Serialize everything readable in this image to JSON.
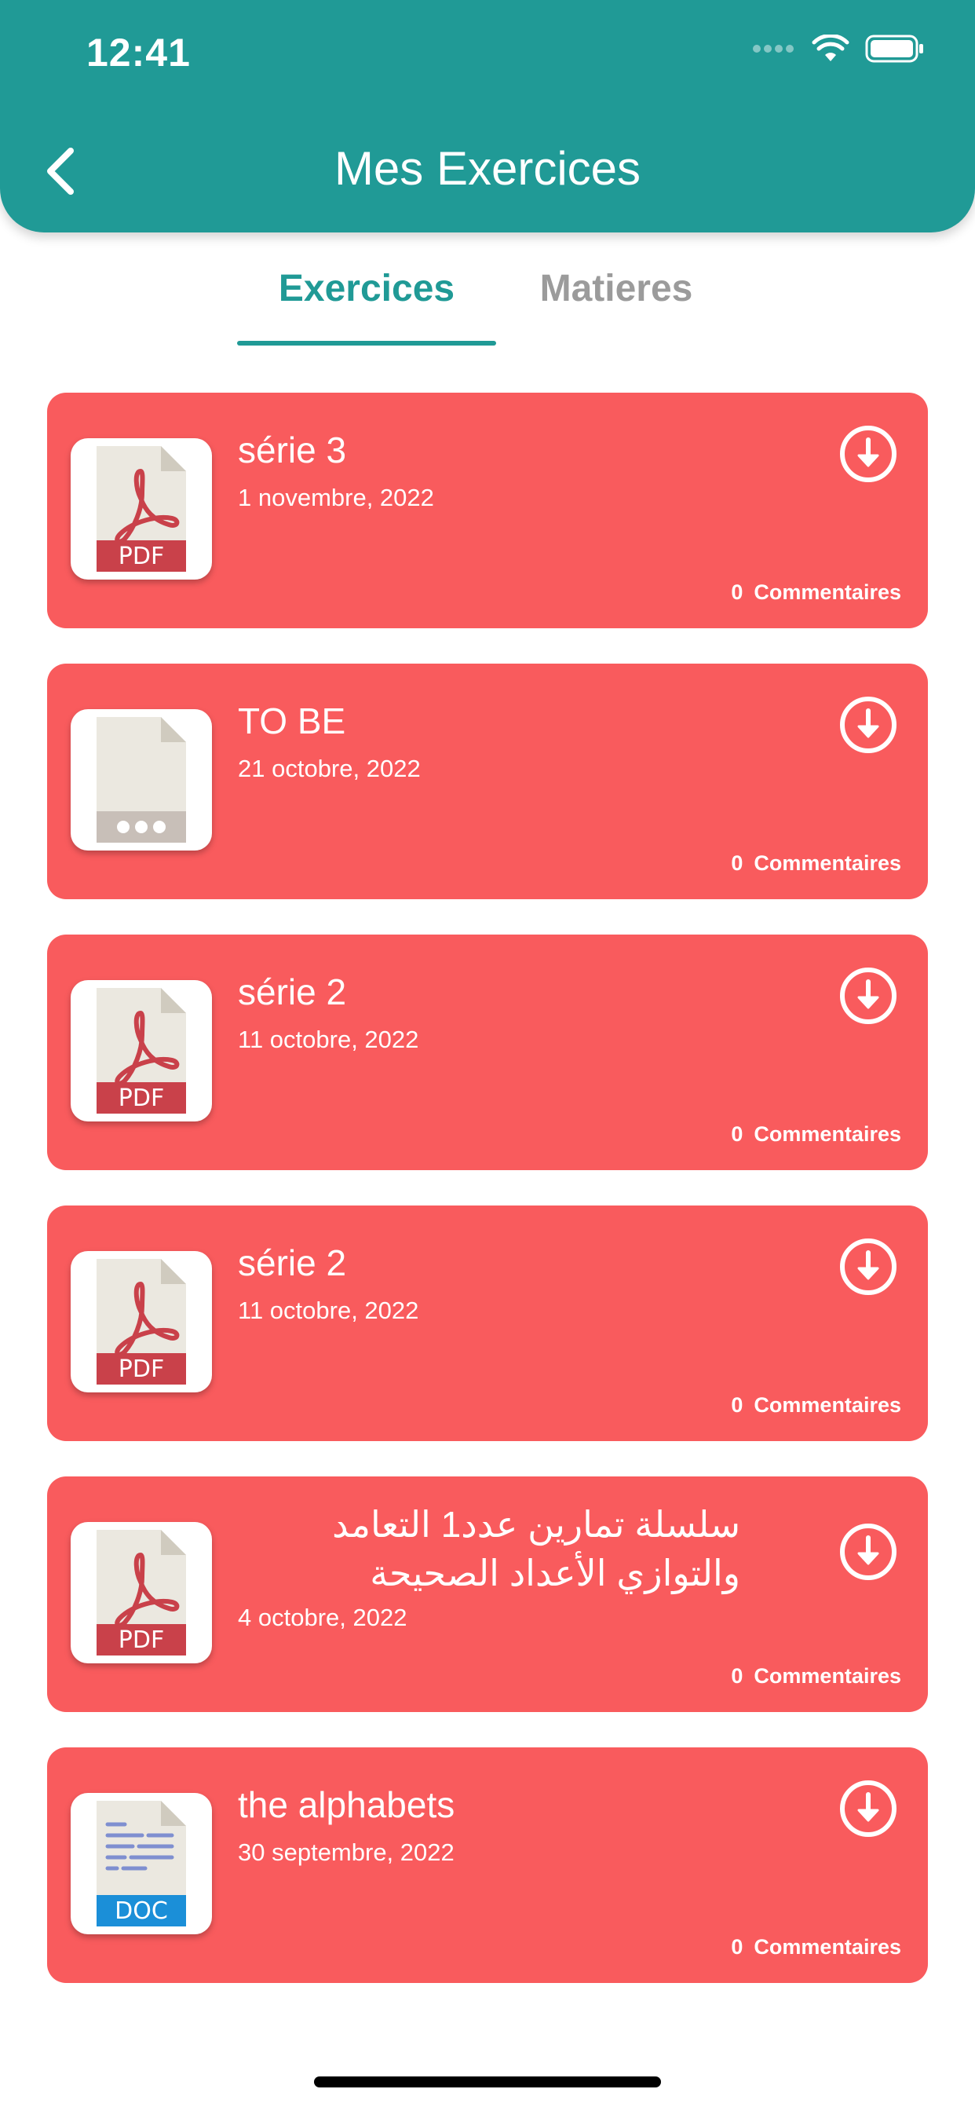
{
  "status_bar": {
    "time": "12:41"
  },
  "header": {
    "title": "Mes Exercices"
  },
  "tabs": [
    {
      "label": "Exercices",
      "active": true
    },
    {
      "label": "Matieres",
      "active": false
    }
  ],
  "exercises": [
    {
      "title": "série 3",
      "date": "1 novembre, 2022",
      "file_type": "pdf",
      "file_label": "PDF",
      "comments_count": "0",
      "comments_label": "Commentaires"
    },
    {
      "title": "TO BE",
      "date": "21 octobre, 2022",
      "file_type": "generic",
      "file_label": "",
      "comments_count": "0",
      "comments_label": "Commentaires"
    },
    {
      "title": "série 2",
      "date": "11 octobre, 2022",
      "file_type": "pdf",
      "file_label": "PDF",
      "comments_count": "0",
      "comments_label": "Commentaires"
    },
    {
      "title": "série 2",
      "date": "11 octobre, 2022",
      "file_type": "pdf",
      "file_label": "PDF",
      "comments_count": "0",
      "comments_label": "Commentaires"
    },
    {
      "title": "سلسلة تمارين عدد1 التعامد والتوازي الأعداد الصحيحة",
      "date": "4 octobre, 2022",
      "file_type": "pdf",
      "file_label": "PDF",
      "comments_count": "0",
      "comments_label": "Commentaires"
    },
    {
      "title": "the alphabets",
      "date": "30 septembre, 2022",
      "file_type": "doc",
      "file_label": "DOC",
      "comments_count": "0",
      "comments_label": "Commentaires"
    }
  ],
  "colors": {
    "primary": "#209a96",
    "card": "#f95b5d",
    "tab_inactive": "#9b9b9b"
  }
}
